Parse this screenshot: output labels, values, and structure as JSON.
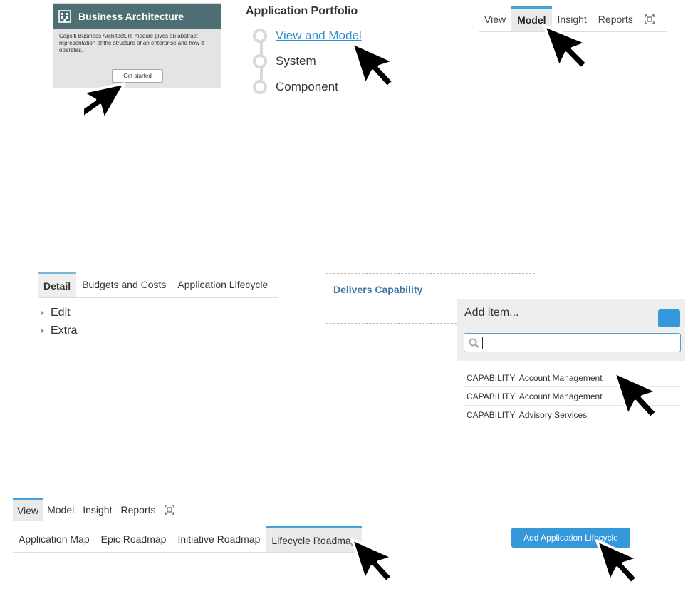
{
  "card": {
    "title": "Business Architecture",
    "description": "Capsifi Business Architecture module gives an abstract representation of the structure of an enterprise and how it operates.",
    "button": "Get started",
    "header_color": "#4d6e73"
  },
  "portfolio": {
    "title": "Application Portfolio",
    "items": [
      {
        "label": "View and Model",
        "link": true
      },
      {
        "label": "System",
        "link": false
      },
      {
        "label": "Component",
        "link": false
      }
    ],
    "link_color": "#2b8fc9"
  },
  "top_nav": {
    "tabs": [
      "View",
      "Model",
      "Insight",
      "Reports"
    ],
    "active": "Model",
    "expand_icon": "expand-icon"
  },
  "detail": {
    "tabs": [
      "Detail",
      "Budgets and Costs",
      "Application Lifecycle"
    ],
    "active": "Detail",
    "tree": [
      "Edit",
      "Extra"
    ]
  },
  "capability": {
    "section_title": "Delivers Capability",
    "add_label": "Add item...",
    "add_button": "+",
    "search_icon": "search-icon",
    "results": [
      "CAPABILITY: Account Management",
      "CAPABILITY: Account Management",
      "CAPABILITY: Advisory Services"
    ]
  },
  "bottom_nav": {
    "tabs": [
      "View",
      "Model",
      "Insight",
      "Reports"
    ],
    "active": "View",
    "expand_icon": "expand-icon"
  },
  "roadmap_tabs": {
    "tabs": [
      "Application Map",
      "Epic Roadmap",
      "Initiative Roadmap",
      "Lifecycle Roadmap"
    ],
    "active": "Lifecycle Roadmap"
  },
  "add_lifecycle_button": "Add Application Lifecycle",
  "accent_color": "#3598db"
}
